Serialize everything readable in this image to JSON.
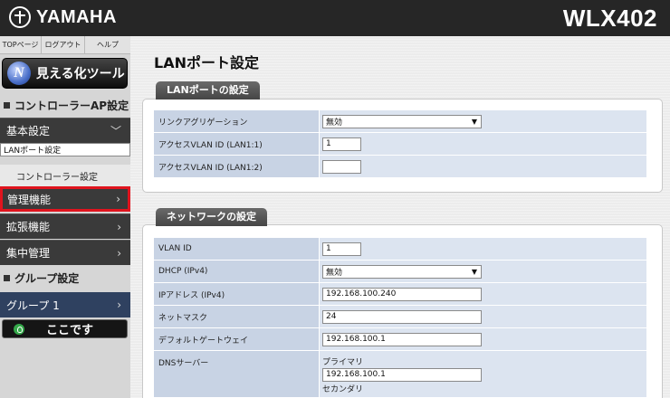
{
  "header": {
    "brand": "YAMAHA",
    "model": "WLX402"
  },
  "sidebar": {
    "top_links": [
      "TOPページ",
      "ログアウト",
      "ヘルプ"
    ],
    "visualize_button": "見える化ツール",
    "section_controller": "コントローラーAP設定",
    "basic_settings": "基本設定",
    "sub_items": [
      "LANポート設定",
      "コントローラー設定"
    ],
    "menus": [
      "管理機能",
      "拡張機能",
      "集中管理"
    ],
    "section_group": "グループ設定",
    "group_name": "グループ 1",
    "here_button": "ここです"
  },
  "main": {
    "page_title": "LANポート設定",
    "lan_section": {
      "tab": "LANポートの設定",
      "rows": [
        {
          "label": "リンクアグリゲーション",
          "value": "無効"
        },
        {
          "label": "アクセスVLAN ID (LAN1:1)",
          "value": "1"
        },
        {
          "label": "アクセスVLAN ID (LAN1:2)",
          "value": ""
        }
      ]
    },
    "network_section": {
      "tab": "ネットワークの設定",
      "rows": [
        {
          "label": "VLAN ID",
          "value": "1"
        },
        {
          "label": "DHCP (IPv4)",
          "value": "無効"
        },
        {
          "label": "IPアドレス (IPv4)",
          "value": "192.168.100.240"
        },
        {
          "label": "ネットマスク",
          "value": "24"
        },
        {
          "label": "デフォルトゲートウェイ",
          "value": "192.168.100.1"
        },
        {
          "label": "DNSサーバー",
          "primary_caption": "プライマリ",
          "primary_value": "192.168.100.1",
          "secondary_caption": "セカンダリ"
        }
      ]
    }
  },
  "colors": {
    "header_bg": "#262626",
    "active_border": "#e0141e",
    "label_cell": "#c8d3e4",
    "value_cell": "#dce4f0"
  }
}
